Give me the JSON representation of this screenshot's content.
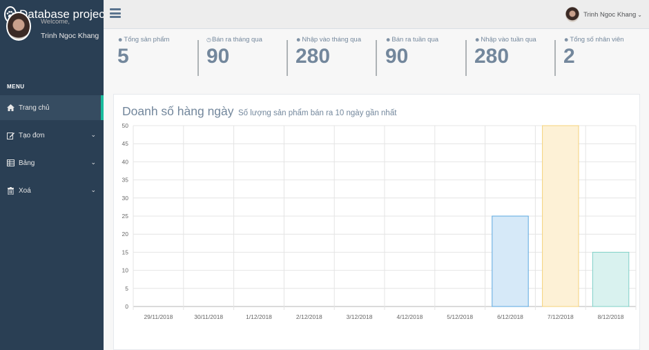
{
  "app": {
    "title": "Database project!",
    "logo_icon": "paw-icon"
  },
  "profile": {
    "welcome": "Welcome,",
    "name": "Trinh Ngoc Khang"
  },
  "sidebar": {
    "menu_heading": "MENU",
    "accent": "#1abb9c",
    "items": [
      {
        "label": "Trang chủ",
        "icon": "home-icon",
        "active": true
      },
      {
        "label": "Tạo đơn",
        "icon": "edit-icon",
        "has_submenu": true
      },
      {
        "label": "Bảng",
        "icon": "table-icon",
        "has_submenu": true
      },
      {
        "label": "Xoá",
        "icon": "trash-icon",
        "has_submenu": true
      }
    ]
  },
  "topbar": {
    "user_name": "Trinh Ngoc Khang",
    "menu_icon": "hamburger-icon"
  },
  "stats": [
    {
      "label": "Tổng sản phẩm",
      "value": "5",
      "icon": "user-icon"
    },
    {
      "label": "Bán ra tháng qua",
      "value": "90",
      "icon": "clock-icon"
    },
    {
      "label": "Nhập vào tháng qua",
      "value": "280",
      "icon": "user-icon"
    },
    {
      "label": "Bán ra tuần qua",
      "value": "90",
      "icon": "user-icon"
    },
    {
      "label": "Nhập vào tuần qua",
      "value": "280",
      "icon": "user-icon"
    },
    {
      "label": "Tổng số nhân viên",
      "value": "2",
      "icon": "user-icon"
    }
  ],
  "panel": {
    "title": "Doanh số hàng ngày",
    "subtitle": "Số lượng sản phẩm bán ra 10 ngày gần nhất"
  },
  "chart_data": {
    "type": "bar",
    "categories": [
      "29/11/2018",
      "30/11/2018",
      "1/12/2018",
      "2/12/2018",
      "3/12/2018",
      "4/12/2018",
      "5/12/2018",
      "6/12/2018",
      "7/12/2018",
      "8/12/2018"
    ],
    "values": [
      0,
      0,
      0,
      0,
      0,
      0,
      0,
      25,
      50,
      15
    ],
    "bar_colors": [
      "#d6e9f8",
      "#d6e9f8",
      "#d6e9f8",
      "#d6e9f8",
      "#d6e9f8",
      "#d6e9f8",
      "#d6e9f8",
      "#d6e9f8",
      "#fdf1d6",
      "#d9f2ef"
    ],
    "bar_borders": [
      "#5aa7e0",
      "#5aa7e0",
      "#5aa7e0",
      "#5aa7e0",
      "#5aa7e0",
      "#5aa7e0",
      "#5aa7e0",
      "#5aa7e0",
      "#f5d27a",
      "#7fd0c7"
    ],
    "ylim": [
      0,
      50
    ],
    "yticks": [
      0,
      5,
      10,
      15,
      20,
      25,
      30,
      35,
      40,
      45,
      50
    ],
    "grid": true,
    "legend": "none",
    "xlabel": "",
    "ylabel": ""
  }
}
